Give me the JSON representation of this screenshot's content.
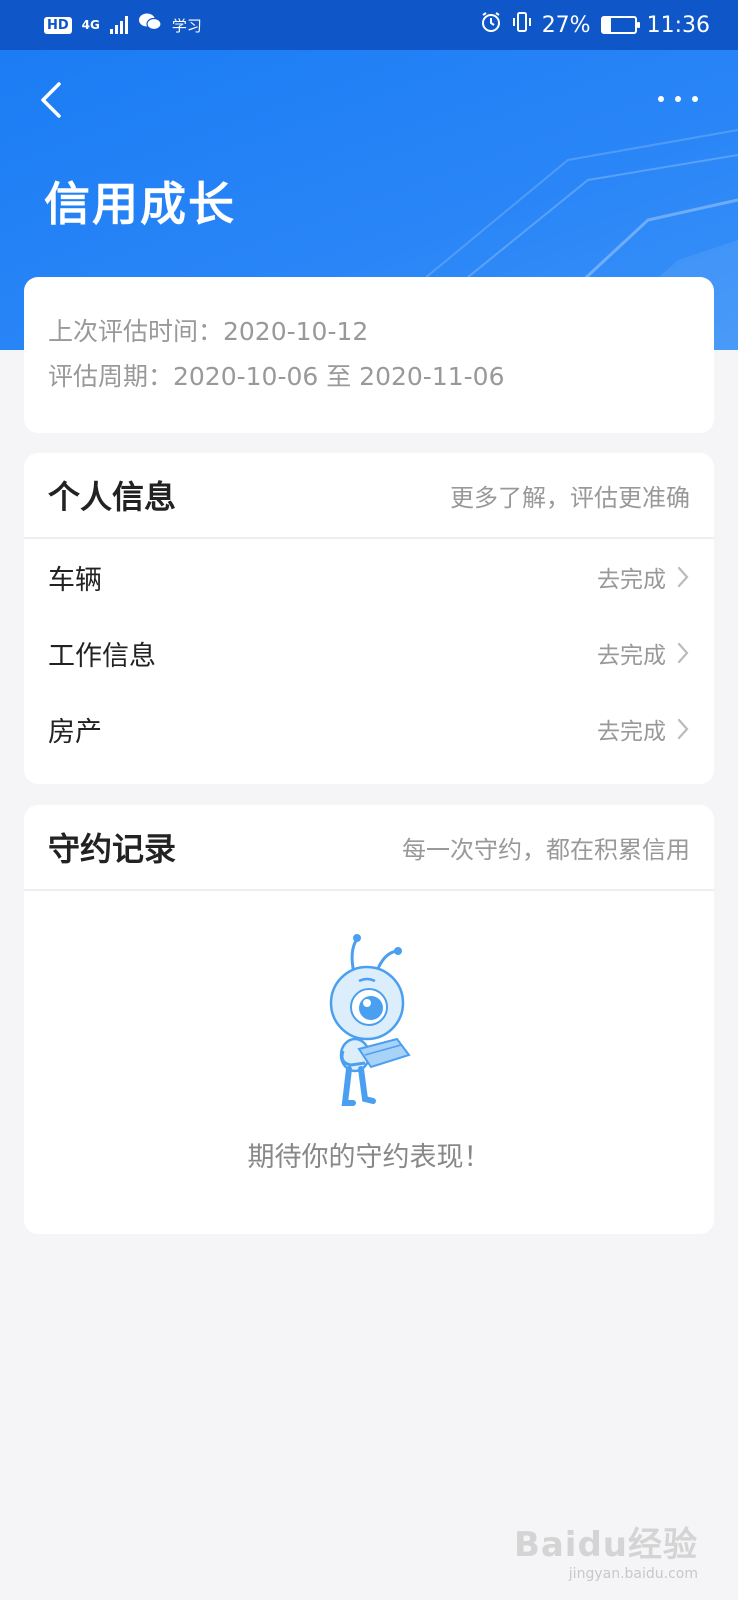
{
  "status_bar": {
    "hd": "HD",
    "network": "4G",
    "app_text": "学习",
    "battery": "27%",
    "battery_level": 0.27,
    "time": "11:36"
  },
  "header": {
    "title": "信用成长",
    "back_icon": "chevron-left-icon",
    "more_icon": "more-dots-icon"
  },
  "evaluation": {
    "last_eval": "上次评估时间：2020-10-12",
    "period": "评估周期：2020-10-06 至 2020-11-06"
  },
  "personal_info": {
    "title": "个人信息",
    "subtitle": "更多了解，评估更准确",
    "items": [
      {
        "label": "车辆",
        "action": "去完成"
      },
      {
        "label": "工作信息",
        "action": "去完成"
      },
      {
        "label": "房产",
        "action": "去完成"
      }
    ]
  },
  "records": {
    "title": "守约记录",
    "subtitle": "每一次守约，都在积累信用",
    "empty_text": "期待你的守约表现！"
  },
  "watermark": {
    "main": "Baidu经验",
    "sub": "jingyan.baidu.com"
  },
  "colors": {
    "brand": "#1b7cf4",
    "status_bar": "#0f57c8",
    "background": "#f5f5f7"
  }
}
